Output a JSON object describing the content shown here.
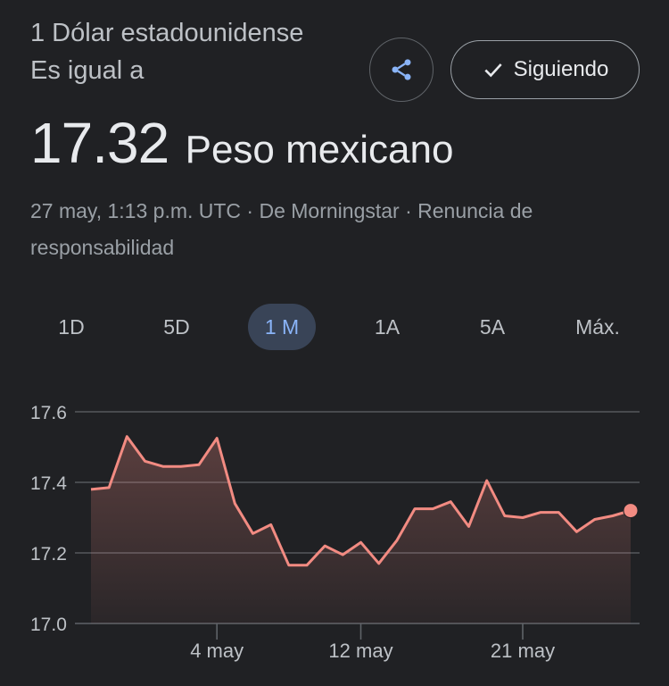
{
  "header": {
    "from_text": "1 Dólar estadounidense Es igual a",
    "rate_value": "17.32",
    "rate_currency": "Peso mexicano",
    "share_icon": "share-icon",
    "follow_icon": "check-icon",
    "follow_label": "Siguiendo"
  },
  "meta": {
    "text": "27 may, 1:13 p.m. UTC · De Morningstar · Renuncia de responsabilidad"
  },
  "tabs": [
    {
      "label": "1D"
    },
    {
      "label": "5D"
    },
    {
      "label": "1 M",
      "active": true
    },
    {
      "label": "1A"
    },
    {
      "label": "5A"
    },
    {
      "label": "Máx."
    }
  ],
  "colors": {
    "background": "#202124",
    "line": "#f28b82",
    "grid": "#5f6368",
    "active_tab_bg": "#394457",
    "active_tab_text": "#8ab4f8"
  },
  "chart_data": {
    "type": "area",
    "y_ticks": [
      "17.6",
      "17.4",
      "17.2",
      "17.0"
    ],
    "ylim": [
      17.0,
      17.6
    ],
    "x_ticks": [
      {
        "label": "4 may",
        "date": "2023-05-04"
      },
      {
        "label": "12 may",
        "date": "2023-05-12"
      },
      {
        "label": "21 may",
        "date": "2023-05-21"
      }
    ],
    "x": [
      "2023-04-27",
      "2023-04-28",
      "2023-04-29",
      "2023-04-30",
      "2023-05-01",
      "2023-05-02",
      "2023-05-03",
      "2023-05-04",
      "2023-05-05",
      "2023-05-06",
      "2023-05-07",
      "2023-05-08",
      "2023-05-09",
      "2023-05-10",
      "2023-05-11",
      "2023-05-12",
      "2023-05-13",
      "2023-05-14",
      "2023-05-15",
      "2023-05-16",
      "2023-05-17",
      "2023-05-18",
      "2023-05-19",
      "2023-05-20",
      "2023-05-21",
      "2023-05-22",
      "2023-05-23",
      "2023-05-24",
      "2023-05-25",
      "2023-05-26",
      "2023-05-27"
    ],
    "series": [
      {
        "values": [
          17.38,
          17.385,
          17.53,
          17.46,
          17.445,
          17.445,
          17.45,
          17.525,
          17.34,
          17.255,
          17.28,
          17.165,
          17.165,
          17.22,
          17.195,
          17.23,
          17.17,
          17.235,
          17.325,
          17.325,
          17.345,
          17.275,
          17.405,
          17.305,
          17.3,
          17.315,
          17.315,
          17.26,
          17.295,
          17.305,
          17.32
        ]
      }
    ],
    "grid": true,
    "last_point_marker": true
  }
}
